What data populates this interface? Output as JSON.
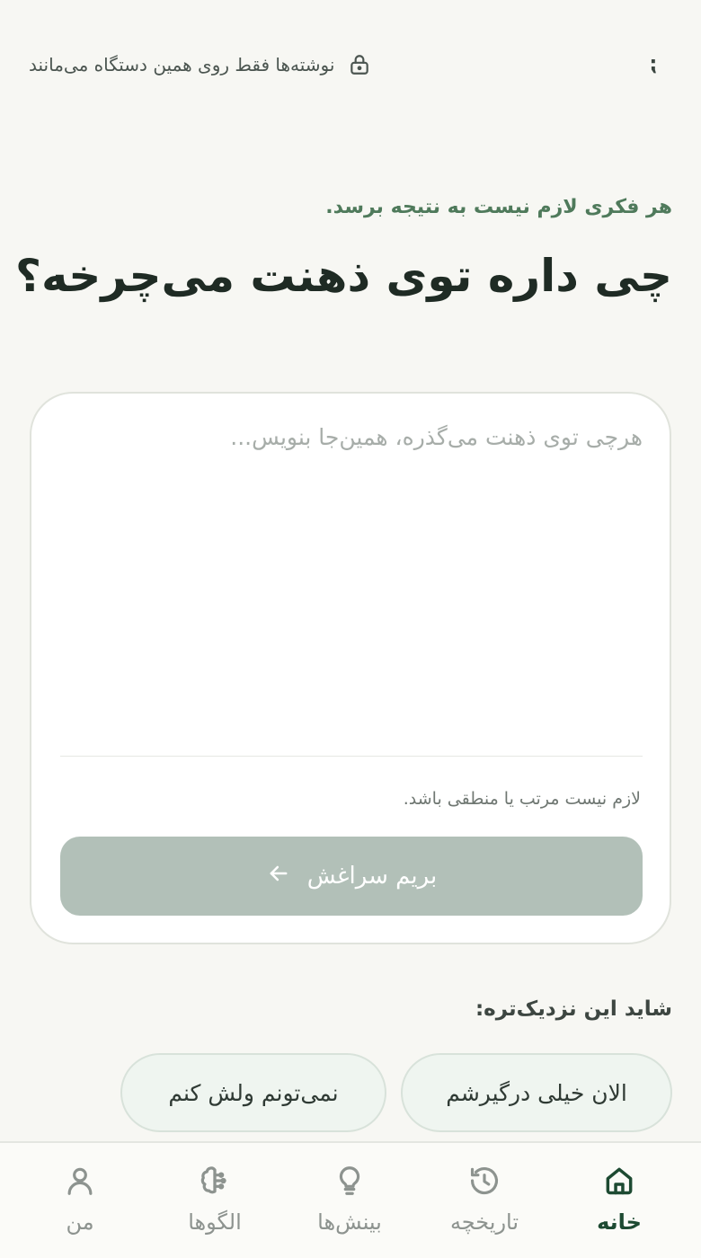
{
  "header": {
    "menu_glyph": "⁏",
    "privacy_note": "نوشته‌ها فقط روی همین دستگاه می‌مانند",
    "privacy_icon": "lock-icon"
  },
  "intro": {
    "subtitle": "هر فکری لازم نیست به نتیجه برسد.",
    "headline": "چی داره توی ذهنت می‌چرخه؟"
  },
  "composer": {
    "value": "",
    "placeholder": "هرچی توی ذهنت می‌گذره، همین‌جا بنویس...",
    "hint": "لازم نیست مرتب یا منطقی باشد.",
    "submit_label": "بریم سراغش",
    "submit_icon": "arrow-left-icon"
  },
  "suggestions": {
    "title": "شاید این نزدیک‌تره:",
    "items": [
      "الان خیلی درگیرشم",
      "نمی‌تونم ولش کنم"
    ]
  },
  "nav": {
    "items": [
      {
        "label": "خانه",
        "icon": "home-icon",
        "active": true
      },
      {
        "label": "تاریخچه",
        "icon": "history-icon",
        "active": false
      },
      {
        "label": "بینش‌ها",
        "icon": "lightbulb-icon",
        "active": false
      },
      {
        "label": "الگوها",
        "icon": "brain-icon",
        "active": false
      },
      {
        "label": "من",
        "icon": "user-icon",
        "active": false
      }
    ]
  },
  "colors": {
    "background": "#f7f7f3",
    "accent_green": "#1d4a32",
    "subtitle_green": "#4f7a5b",
    "button_disabled": "#b2c0b8",
    "chip_bg": "#eff5f0"
  }
}
